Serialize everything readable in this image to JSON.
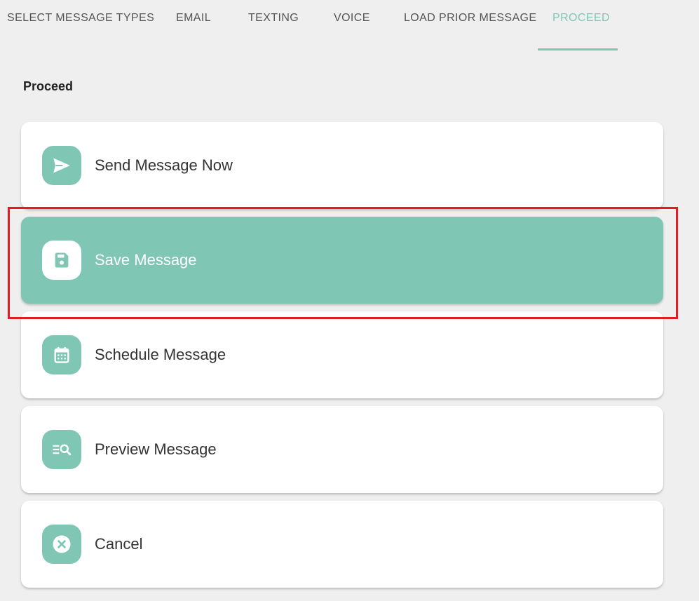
{
  "tabs": [
    {
      "label": "SELECT MESSAGE TYPES"
    },
    {
      "label": "EMAIL"
    },
    {
      "label": "TEXTING"
    },
    {
      "label": "VOICE"
    },
    {
      "label": "LOAD PRIOR MESSAGE"
    },
    {
      "label": "PROCEED"
    }
  ],
  "active_tab": "PROCEED",
  "section_title": "Proceed",
  "actions": [
    {
      "label": "Send Message Now",
      "icon": "send-icon"
    },
    {
      "label": "Save Message",
      "icon": "save-icon",
      "selected": true
    },
    {
      "label": "Schedule Message",
      "icon": "calendar-icon"
    },
    {
      "label": "Preview Message",
      "icon": "preview-search-icon"
    },
    {
      "label": "Cancel",
      "icon": "cancel-icon"
    }
  ],
  "colors": {
    "accent": "#7fc6b4",
    "background": "#efefef",
    "highlight": "#e31c23"
  }
}
